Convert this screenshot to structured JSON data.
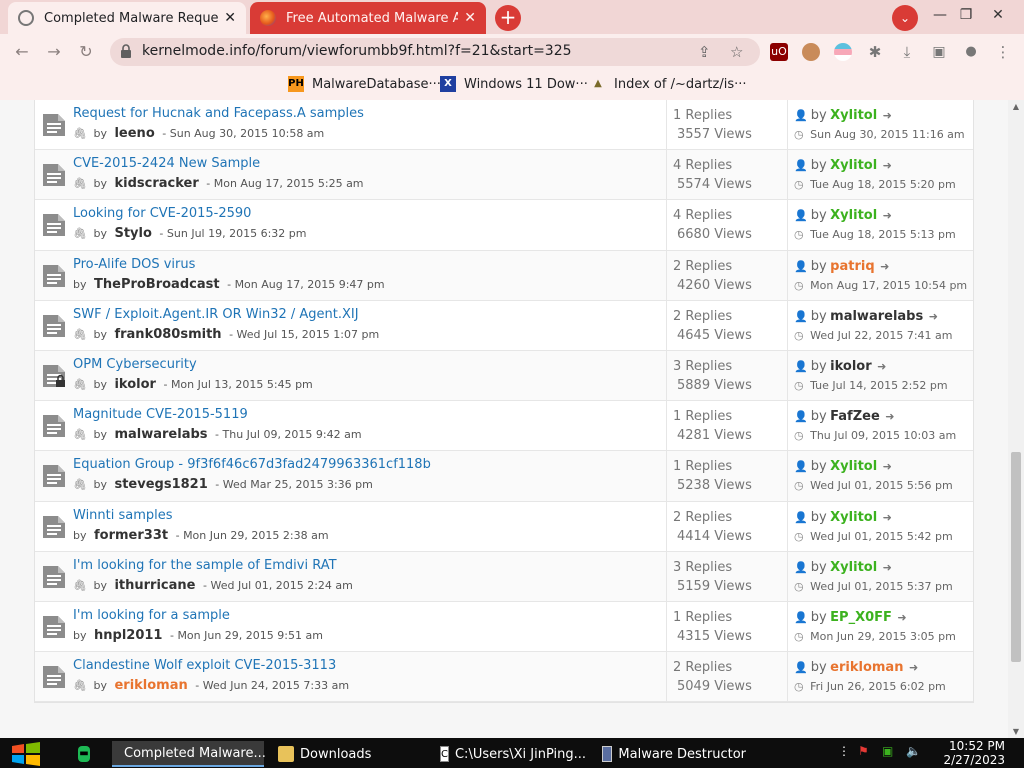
{
  "browser": {
    "tabs": [
      {
        "title": "Completed Malware Requests",
        "active": true
      },
      {
        "title": "Free Automated Malware Analy",
        "active": false
      }
    ],
    "url": "kernelmode.info/forum/viewforumbb9f.html?f=21&start=325",
    "bookmarks": [
      {
        "label": "MalwareDatabase···",
        "icon": "ph-icon"
      },
      {
        "label": "Windows 11 Dow···",
        "icon": "x-icon"
      },
      {
        "label": "Index of /~dartz/is···",
        "icon": "folder-icon"
      }
    ],
    "accent": "#d93b36"
  },
  "topics": [
    {
      "title": "Request for Hucnak and Facepass.A samples",
      "clip": true,
      "author": "leeno",
      "author_color": "normal",
      "date": "Sun Aug 30, 2015 10:58 am",
      "replies": "1 Replies",
      "views": "3557 Views",
      "last_user": "Xylitol",
      "last_color": "green",
      "last_date": "Sun Aug 30, 2015 11:16 am",
      "locked": false
    },
    {
      "title": "CVE-2015-2424 New Sample",
      "clip": true,
      "author": "kidscracker",
      "author_color": "normal",
      "date": "Mon Aug 17, 2015 5:25 am",
      "replies": "4 Replies",
      "views": "5574 Views",
      "last_user": "Xylitol",
      "last_color": "green",
      "last_date": "Tue Aug 18, 2015 5:20 pm",
      "locked": false
    },
    {
      "title": "Looking for CVE-2015-2590",
      "clip": true,
      "author": "Stylo",
      "author_color": "normal",
      "date": "Sun Jul 19, 2015 6:32 pm",
      "replies": "4 Replies",
      "views": "6680 Views",
      "last_user": "Xylitol",
      "last_color": "green",
      "last_date": "Tue Aug 18, 2015 5:13 pm",
      "locked": false
    },
    {
      "title": "Pro-Alife DOS virus",
      "clip": false,
      "author": "TheProBroadcast",
      "author_color": "normal",
      "date": "Mon Aug 17, 2015 9:47 pm",
      "replies": "2 Replies",
      "views": "4260 Views",
      "last_user": "patriq",
      "last_color": "orange",
      "last_date": "Mon Aug 17, 2015 10:54 pm",
      "locked": false
    },
    {
      "title": "SWF / Exploit.Agent.IR OR Win32 / Agent.XIJ",
      "clip": true,
      "author": "frank080smith",
      "author_color": "normal",
      "date": "Wed Jul 15, 2015 1:07 pm",
      "replies": "2 Replies",
      "views": "4645 Views",
      "last_user": "malwarelabs",
      "last_color": "normal",
      "last_date": "Wed Jul 22, 2015 7:41 am",
      "locked": false
    },
    {
      "title": "OPM Cybersecurity",
      "clip": true,
      "author": "ikolor",
      "author_color": "normal",
      "date": "Mon Jul 13, 2015 5:45 pm",
      "replies": "3 Replies",
      "views": "5889 Views",
      "last_user": "ikolor",
      "last_color": "normal",
      "last_date": "Tue Jul 14, 2015 2:52 pm",
      "locked": true
    },
    {
      "title": "Magnitude CVE-2015-5119",
      "clip": true,
      "author": "malwarelabs",
      "author_color": "normal",
      "date": "Thu Jul 09, 2015 9:42 am",
      "replies": "1 Replies",
      "views": "4281 Views",
      "last_user": "FafZee",
      "last_color": "normal",
      "last_date": "Thu Jul 09, 2015 10:03 am",
      "locked": false
    },
    {
      "title": "Equation Group - 9f3f6f46c67d3fad2479963361cf118b",
      "clip": true,
      "author": "stevegs1821",
      "author_color": "normal",
      "date": "Wed Mar 25, 2015 3:36 pm",
      "replies": "1 Replies",
      "views": "5238 Views",
      "last_user": "Xylitol",
      "last_color": "green",
      "last_date": "Wed Jul 01, 2015 5:56 pm",
      "locked": false
    },
    {
      "title": "Winnti samples",
      "clip": false,
      "author": "former33t",
      "author_color": "normal",
      "date": "Mon Jun 29, 2015 2:38 am",
      "replies": "2 Replies",
      "views": "4414 Views",
      "last_user": "Xylitol",
      "last_color": "green",
      "last_date": "Wed Jul 01, 2015 5:42 pm",
      "locked": false
    },
    {
      "title": "I'm looking for the sample of Emdivi RAT",
      "clip": true,
      "author": "ithurricane",
      "author_color": "normal",
      "date": "Wed Jul 01, 2015 2:24 am",
      "replies": "3 Replies",
      "views": "5159 Views",
      "last_user": "Xylitol",
      "last_color": "green",
      "last_date": "Wed Jul 01, 2015 5:37 pm",
      "locked": false
    },
    {
      "title": "I'm looking for a sample",
      "clip": false,
      "author": "hnpl2011",
      "author_color": "normal",
      "date": "Mon Jun 29, 2015 9:51 am",
      "replies": "1 Replies",
      "views": "4315 Views",
      "last_user": "EP_X0FF",
      "last_color": "green",
      "last_date": "Mon Jun 29, 2015 3:05 pm",
      "locked": false
    },
    {
      "title": "Clandestine Wolf exploit CVE-2015-3113",
      "clip": true,
      "author": "erikloman",
      "author_color": "orange",
      "date": "Wed Jun 24, 2015 7:33 am",
      "replies": "2 Replies",
      "views": "5049 Views",
      "last_user": "erikloman",
      "last_color": "orange",
      "last_date": "Fri Jun 26, 2015 6:02 pm",
      "locked": false
    }
  ],
  "labels": {
    "by": "by",
    "sep": "-"
  },
  "taskbar": {
    "items": [
      {
        "label": "Completed Malware...",
        "icon": "chrome-icon",
        "selected": true
      },
      {
        "label": "Downloads",
        "icon": "folder-icon",
        "selected": false
      },
      {
        "label": "C:\\Users\\Xi JinPing...",
        "icon": "terminal-icon",
        "selected": false
      },
      {
        "label": "Malware Destructor",
        "icon": "window-icon",
        "selected": false
      }
    ],
    "time": "10:52 PM",
    "date": "2/27/2023"
  }
}
